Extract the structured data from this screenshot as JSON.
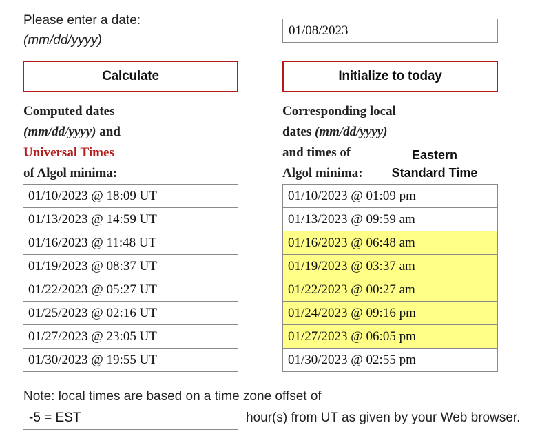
{
  "prompt": {
    "line1": "Please enter a date:",
    "line2": "(mm/dd/yyyy)"
  },
  "date_input": {
    "value": "01/08/2023"
  },
  "buttons": {
    "calculate": "Calculate",
    "initialize": "Initialize to today"
  },
  "left_heading": {
    "line1": "Computed dates",
    "line2_em": "(mm/dd/yyyy)",
    "line2_rest": " and",
    "line3": "Universal Times",
    "line4": "of Algol minima:"
  },
  "right_heading": {
    "line1": "Corresponding local",
    "line2_pre": "dates ",
    "line2_em": "(mm/dd/yyyy)",
    "line3": "and times of",
    "line4": "Algol minima:"
  },
  "timezone_label": {
    "line1": "Eastern",
    "line2": "Standard Time"
  },
  "ut_times": [
    "01/10/2023 @ 18:09 UT",
    "01/13/2023 @ 14:59 UT",
    "01/16/2023 @ 11:48 UT",
    "01/19/2023 @ 08:37 UT",
    "01/22/2023 @ 05:27 UT",
    "01/25/2023 @ 02:16 UT",
    "01/27/2023 @ 23:05 UT",
    "01/30/2023 @ 19:55 UT"
  ],
  "local_times": [
    {
      "text": "01/10/2023 @ 01:09 pm",
      "highlighted": false
    },
    {
      "text": "01/13/2023 @ 09:59 am",
      "highlighted": false
    },
    {
      "text": "01/16/2023 @ 06:48 am",
      "highlighted": true
    },
    {
      "text": "01/19/2023 @ 03:37 am",
      "highlighted": true
    },
    {
      "text": "01/22/2023 @ 00:27 am",
      "highlighted": true
    },
    {
      "text": "01/24/2023 @ 09:16 pm",
      "highlighted": true
    },
    {
      "text": "01/27/2023 @ 06:05 pm",
      "highlighted": true
    },
    {
      "text": "01/30/2023 @ 02:55 pm",
      "highlighted": false
    }
  ],
  "colors": {
    "accent_red": "#b31b1b",
    "highlight_yellow": "#ffff88"
  },
  "note": {
    "line1": "Note: local times are based on a time zone offset of",
    "offset_value": "-5 = EST",
    "line2": "hour(s) from UT as given by your Web browser."
  }
}
